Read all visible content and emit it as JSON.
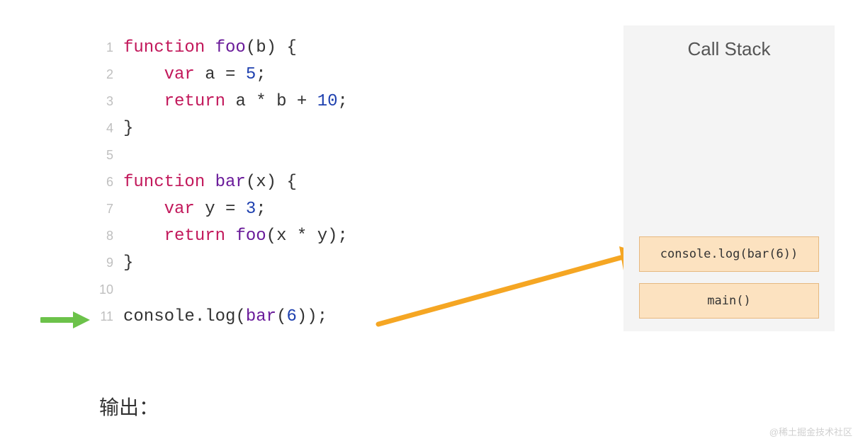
{
  "code": {
    "lines": [
      {
        "n": "1",
        "tokens": [
          [
            "kw",
            "function "
          ],
          [
            "fn",
            "foo"
          ],
          [
            "op",
            "("
          ],
          [
            "pl",
            "b"
          ],
          [
            "op",
            ") {"
          ]
        ]
      },
      {
        "n": "2",
        "tokens": [
          [
            "pl",
            "    "
          ],
          [
            "kw",
            "var "
          ],
          [
            "pl",
            "a "
          ],
          [
            "op",
            "= "
          ],
          [
            "num",
            "5"
          ],
          [
            "op",
            ";"
          ]
        ]
      },
      {
        "n": "3",
        "tokens": [
          [
            "pl",
            "    "
          ],
          [
            "kw",
            "return "
          ],
          [
            "pl",
            "a "
          ],
          [
            "op",
            "* "
          ],
          [
            "pl",
            "b "
          ],
          [
            "op",
            "+ "
          ],
          [
            "num",
            "10"
          ],
          [
            "op",
            ";"
          ]
        ]
      },
      {
        "n": "4",
        "tokens": [
          [
            "op",
            "}"
          ]
        ]
      },
      {
        "n": "5",
        "tokens": []
      },
      {
        "n": "6",
        "tokens": [
          [
            "kw",
            "function "
          ],
          [
            "fn",
            "bar"
          ],
          [
            "op",
            "("
          ],
          [
            "pl",
            "x"
          ],
          [
            "op",
            ") {"
          ]
        ]
      },
      {
        "n": "7",
        "tokens": [
          [
            "pl",
            "    "
          ],
          [
            "kw",
            "var "
          ],
          [
            "pl",
            "y "
          ],
          [
            "op",
            "= "
          ],
          [
            "num",
            "3"
          ],
          [
            "op",
            ";"
          ]
        ]
      },
      {
        "n": "8",
        "tokens": [
          [
            "pl",
            "    "
          ],
          [
            "kw",
            "return "
          ],
          [
            "fn",
            "foo"
          ],
          [
            "op",
            "("
          ],
          [
            "pl",
            "x "
          ],
          [
            "op",
            "* "
          ],
          [
            "pl",
            "y"
          ],
          [
            "op",
            ");"
          ]
        ]
      },
      {
        "n": "9",
        "tokens": [
          [
            "op",
            "}"
          ]
        ]
      },
      {
        "n": "10",
        "tokens": []
      },
      {
        "n": "11",
        "tokens": [
          [
            "call",
            "console"
          ],
          [
            "op",
            "."
          ],
          [
            "call",
            "log"
          ],
          [
            "op",
            "("
          ],
          [
            "fn",
            "bar"
          ],
          [
            "op",
            "("
          ],
          [
            "num",
            "6"
          ],
          [
            "op",
            "));"
          ]
        ]
      }
    ]
  },
  "stack": {
    "title": "Call Stack",
    "frames_top_to_bottom": [
      "console.log(bar(6))",
      "main()"
    ]
  },
  "output_label": "输出：",
  "watermark": "@稀土掘金技术社区",
  "colors": {
    "keyword": "#c2185b",
    "function": "#6a1b9a",
    "number": "#1e40af",
    "stack_bg": "#f4f4f4",
    "frame_bg": "#fce2c0",
    "frame_border": "#e6b880",
    "green_arrow": "#6cc24a",
    "orange_arrow": "#f5a623"
  },
  "current_line": 11
}
